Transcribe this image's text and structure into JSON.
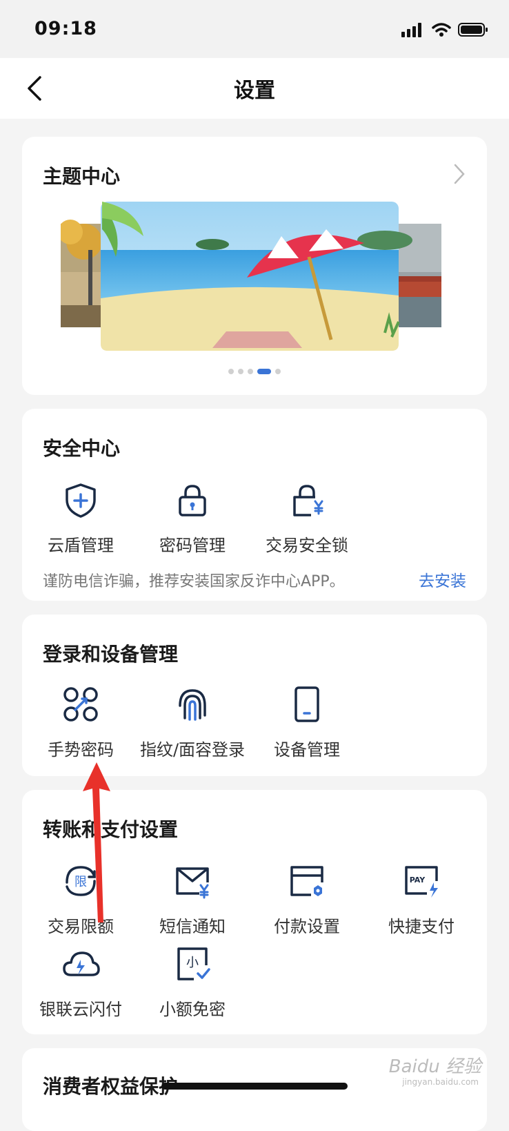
{
  "status": {
    "time": "09:18"
  },
  "nav": {
    "title": "设置"
  },
  "theme": {
    "title": "主题中心",
    "carousel": {
      "pages": 5,
      "active_index": 3
    }
  },
  "security": {
    "title": "安全中心",
    "items": [
      {
        "label": "云盾管理",
        "icon": "shield-plus-icon"
      },
      {
        "label": "密码管理",
        "icon": "lock-icon"
      },
      {
        "label": "交易安全锁",
        "icon": "lock-yen-icon"
      }
    ],
    "tip": "谨防电信诈骗，推荐安装国家反诈中心APP。",
    "tip_link": "去安装"
  },
  "login": {
    "title": "登录和设备管理",
    "items": [
      {
        "label": "手势密码",
        "icon": "gesture-icon"
      },
      {
        "label": "指纹/面容登录",
        "icon": "fingerprint-icon"
      },
      {
        "label": "设备管理",
        "icon": "device-icon"
      }
    ]
  },
  "payment": {
    "title": "转账和支付设置",
    "items": [
      {
        "label": "交易限额",
        "icon": "limit-icon",
        "icon_text": "限"
      },
      {
        "label": "短信通知",
        "icon": "sms-yen-icon"
      },
      {
        "label": "付款设置",
        "icon": "card-gear-icon"
      },
      {
        "label": "快捷支付",
        "icon": "pay-icon",
        "icon_text": "PAY"
      },
      {
        "label": "银联云闪付",
        "icon": "cloud-flash-icon"
      },
      {
        "label": "小额免密",
        "icon": "small-amount-icon",
        "icon_text": "小"
      }
    ]
  },
  "consumer": {
    "title": "消费者权益保护"
  },
  "watermark": {
    "text": "Baidu 经验",
    "sub": "jingyan.baidu.com"
  },
  "colors": {
    "accent": "#3a74d6",
    "icon_dark": "#1a2a44",
    "annotation": "#e8312a"
  }
}
